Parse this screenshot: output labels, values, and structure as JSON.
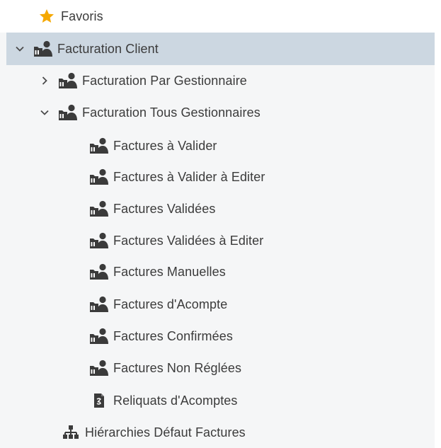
{
  "tree": {
    "favorites": {
      "label": "Favoris",
      "icon": "star-icon",
      "color": "#f5a800"
    },
    "facturation_client": {
      "label": "Facturation Client",
      "expanded": true,
      "selected": true,
      "icon": "users-folder-icon"
    },
    "par_gestionnaire": {
      "label": "Facturation Par Gestionnaire",
      "expanded": false,
      "icon": "users-folder-icon"
    },
    "tous_gestionnaires": {
      "label": "Facturation Tous Gestionnaires",
      "expanded": true,
      "icon": "users-folder-icon"
    },
    "items": [
      {
        "label": "Factures à Valider",
        "icon": "users-folder-icon"
      },
      {
        "label": "Factures à Valider à Editer",
        "icon": "users-folder-icon"
      },
      {
        "label": "Factures Validées",
        "icon": "users-folder-icon"
      },
      {
        "label": "Factures Validées à Editer",
        "icon": "users-folder-icon"
      },
      {
        "label": "Factures Manuelles",
        "icon": "users-folder-icon"
      },
      {
        "label": "Factures d'Acompte",
        "icon": "users-folder-icon"
      },
      {
        "label": "Factures Confirmées",
        "icon": "users-folder-icon"
      },
      {
        "label": "Factures Non Réglées",
        "icon": "users-folder-icon"
      },
      {
        "label": "Reliquats d'Acomptes",
        "icon": "document-icon"
      }
    ],
    "hierarchies": {
      "label": "Hiérarchies Défaut Factures",
      "icon": "hierarchy-icon"
    }
  },
  "colors": {
    "selected_bg": "#ccd7e1",
    "panel_bg": "#f5f6f7",
    "icon_dark": "#3b3b3b",
    "star": "#f5a800"
  }
}
